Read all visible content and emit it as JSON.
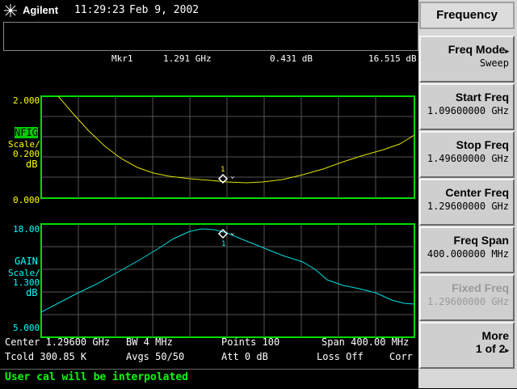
{
  "header": {
    "brand": "Agilent",
    "time": "11:29:23",
    "date": "Feb 9, 2002",
    "logo_icon": "agilent-spark-icon"
  },
  "marker": {
    "name": "Mkr1",
    "freq": "1.291 GHz",
    "nfig": "0.431 dB",
    "gain": "16.515 dB"
  },
  "nfig_plot": {
    "top": "2.000",
    "label": "NFIG",
    "scale_label": "Scale/",
    "scale": "0.200",
    "unit": "dB",
    "bottom": "0.000",
    "marker_num": "1"
  },
  "gain_plot": {
    "top": "18.00",
    "label": "GAIN",
    "scale_label": "Scale/",
    "scale": "1.300",
    "unit": "dB",
    "bottom": "5.000",
    "marker_num": "1"
  },
  "info": {
    "center": "Center 1.29600 GHz",
    "bw": "BW 4 MHz",
    "points": "Points 100",
    "span": "Span 400.00 MHz",
    "tcold": "Tcold 300.85 K",
    "avgs": "Avgs 50/50",
    "att": "Att 0 dB",
    "loss": "Loss Off",
    "corr": "Corr"
  },
  "status": "User cal will be interpolated",
  "softkeys": {
    "title": "Frequency",
    "items": [
      {
        "label": "Freq Mode",
        "value": "Sweep",
        "arrow": "▸"
      },
      {
        "label": "Start Freq",
        "value": "1.09600000 GHz"
      },
      {
        "label": "Stop Freq",
        "value": "1.49600000 GHz"
      },
      {
        "label": "Center Freq",
        "value": "1.29600000 GHz"
      },
      {
        "label": "Freq Span",
        "value": "400.000000 MHz"
      },
      {
        "label": "Fixed Freq",
        "value": "1.29600000 GHz"
      },
      {
        "label": "More",
        "value": "1 of 2",
        "arrow": "▸"
      }
    ]
  },
  "colors": {
    "grid": "#00dd00",
    "nfig_trace": "#ffff00",
    "gain_trace": "#00ffff",
    "status": "#00ff00",
    "corr": "#ffff00"
  }
}
